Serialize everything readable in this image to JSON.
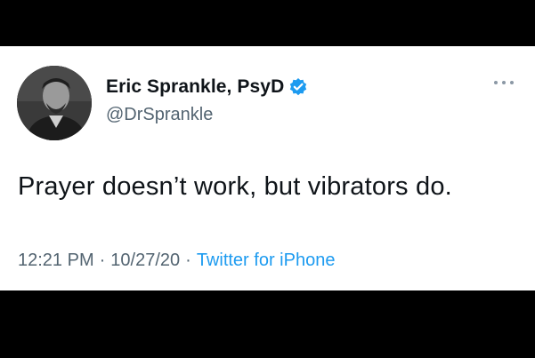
{
  "tweet": {
    "author_name": "Eric Sprankle, PsyD",
    "handle": "@DrSprankle",
    "verified": true,
    "text": "Prayer doesn’t work, but vibrators do.",
    "time": "12:21 PM",
    "date": "10/27/20",
    "separator": "·",
    "source": "Twitter for iPhone"
  },
  "icons": {
    "verified": "verified-badge-icon",
    "more": "more-options-icon"
  },
  "colors": {
    "verified_blue": "#1d9bf0",
    "source_link": "#1d9bf0",
    "secondary_text": "#536471"
  }
}
